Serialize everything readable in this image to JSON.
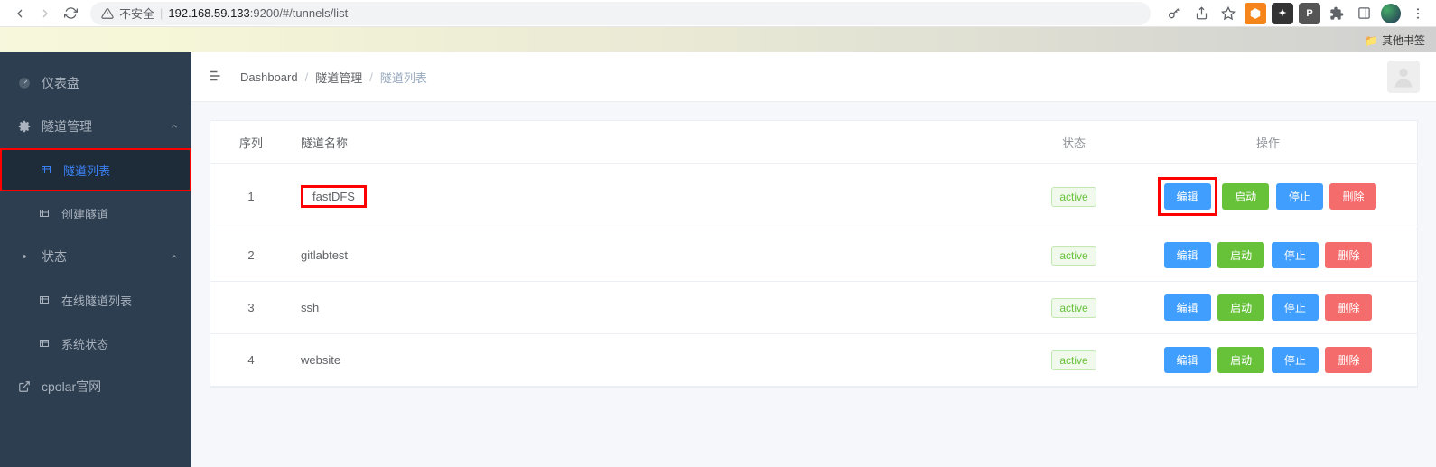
{
  "browser": {
    "insecure_label": "不安全",
    "url_prefix": "192.168.59.133",
    "url_port_path": ":9200/#/tunnels/list",
    "bookmark_other": "其他书签"
  },
  "sidebar": {
    "dashboard": "仪表盘",
    "tunnel_mgmt": "隧道管理",
    "tunnel_list": "隧道列表",
    "tunnel_create": "创建隧道",
    "status": "状态",
    "online_list": "在线隧道列表",
    "sys_status": "系统状态",
    "cpolar": "cpolar官网"
  },
  "breadcrumb": {
    "dashboard": "Dashboard",
    "tunnel_mgmt": "隧道管理",
    "tunnel_list": "隧道列表"
  },
  "table": {
    "headers": {
      "seq": "序列",
      "name": "隧道名称",
      "status": "状态",
      "action": "操作"
    },
    "actions": {
      "edit": "编辑",
      "start": "启动",
      "stop": "停止",
      "del": "删除"
    },
    "rows": [
      {
        "seq": "1",
        "name": "fastDFS",
        "status": "active"
      },
      {
        "seq": "2",
        "name": "gitlabtest",
        "status": "active"
      },
      {
        "seq": "3",
        "name": "ssh",
        "status": "active"
      },
      {
        "seq": "4",
        "name": "website",
        "status": "active"
      }
    ]
  }
}
